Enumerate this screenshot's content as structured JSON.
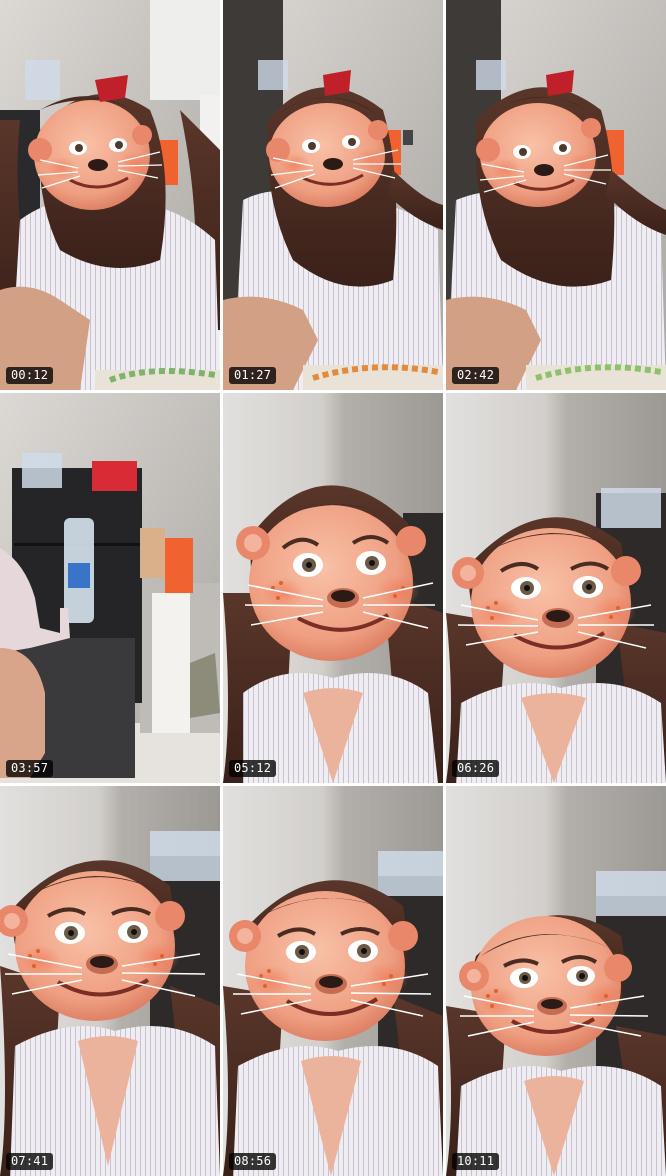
{
  "gallery": {
    "tiles": [
      {
        "timestamp": "00:12",
        "scene": "filter-face-room"
      },
      {
        "timestamp": "01:27",
        "scene": "filter-face-room"
      },
      {
        "timestamp": "02:42",
        "scene": "filter-face-room"
      },
      {
        "timestamp": "03:57",
        "scene": "room-fridge"
      },
      {
        "timestamp": "05:12",
        "scene": "filter-face-closeup"
      },
      {
        "timestamp": "06:26",
        "scene": "filter-face-closeup"
      },
      {
        "timestamp": "07:41",
        "scene": "filter-face-closeup"
      },
      {
        "timestamp": "08:56",
        "scene": "filter-face-closeup"
      },
      {
        "timestamp": "10:11",
        "scene": "filter-face-closeup"
      }
    ]
  },
  "colors": {
    "wall": "#c9c6c2",
    "hair": "#4a2c22",
    "skin": "#f0a58a",
    "ears": "#e8876a",
    "shirt": "#ece9ee",
    "badge_bg": "#000000",
    "badge_text": "#ffffff"
  }
}
